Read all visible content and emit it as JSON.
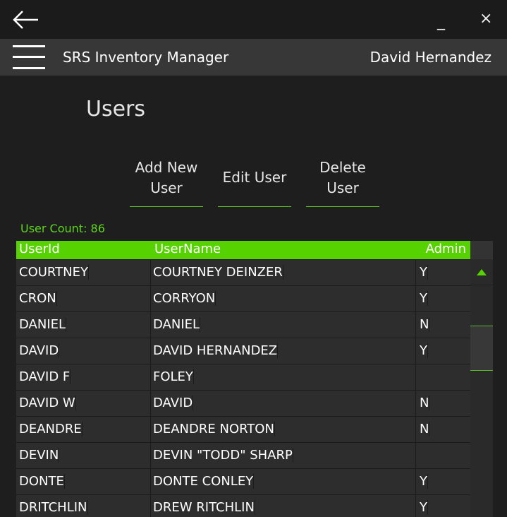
{
  "titlebar": {
    "back_icon": "back-arrow-icon",
    "minimize_glyph": "_",
    "close_glyph": "×"
  },
  "appbar": {
    "menu_icon": "hamburger-menu-icon",
    "title": "SRS Inventory Manager",
    "user": "David Hernandez"
  },
  "page": {
    "title": "Users"
  },
  "actions": {
    "add_line1": "Add New",
    "add_line2": "User",
    "edit": "Edit User",
    "delete_line1": "Delete",
    "delete_line2": "User"
  },
  "user_count": "User Count: 86",
  "grid": {
    "columns": {
      "id": "UserId",
      "name": "UserName",
      "admin": "Admin"
    },
    "rows": [
      {
        "id": "COURTNEY",
        "name": "COURTNEY DEINZER",
        "admin": "Y"
      },
      {
        "id": "CRON",
        "name": "CORRYON",
        "admin": "Y"
      },
      {
        "id": "DANIEL",
        "name": "DANIEL",
        "admin": "N"
      },
      {
        "id": "DAVID",
        "name": "DAVID HERNANDEZ",
        "admin": "Y"
      },
      {
        "id": "DAVID F",
        "name": "FOLEY",
        "admin": ""
      },
      {
        "id": "DAVID W",
        "name": "DAVID",
        "admin": "N"
      },
      {
        "id": "DEANDRE",
        "name": "DEANDRE NORTON",
        "admin": "N"
      },
      {
        "id": "DEVIN",
        "name": "DEVIN \"TODD\" SHARP",
        "admin": ""
      },
      {
        "id": "DONTE",
        "name": "DONTE CONLEY",
        "admin": "Y"
      },
      {
        "id": "DRITCHLIN",
        "name": "DREW RITCHLIN",
        "admin": "Y"
      }
    ]
  },
  "scrollbar": {
    "up_icon": "scroll-up-arrow-icon"
  },
  "colors": {
    "accent": "#55d200",
    "count_text": "#5fd61e",
    "row_bg": "#2d2d2d",
    "appbar_bg": "#373737",
    "background": "#1e1e1e"
  }
}
